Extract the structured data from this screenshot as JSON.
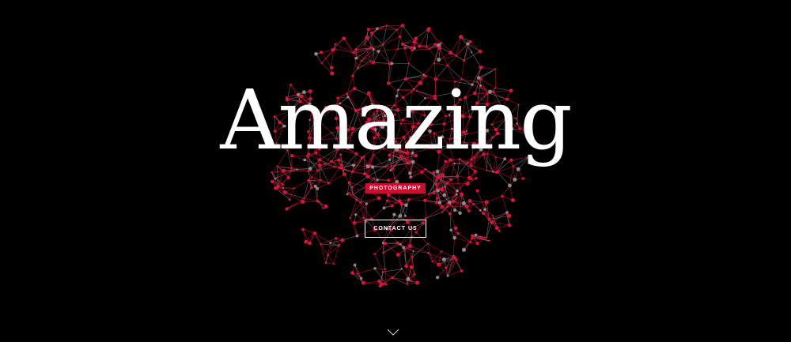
{
  "hero": {
    "title": "Amazing",
    "subtitle": "PHOTOGRAPHY",
    "cta_label": "CONTACT US",
    "scroll_icon": "chevron-down-icon",
    "background_graphic": "network-sphere",
    "colors": {
      "background": "#000000",
      "accent": "#c8102e",
      "text": "#ffffff",
      "node_primary": "#e0103a",
      "node_secondary": "#8a8a8a"
    }
  }
}
